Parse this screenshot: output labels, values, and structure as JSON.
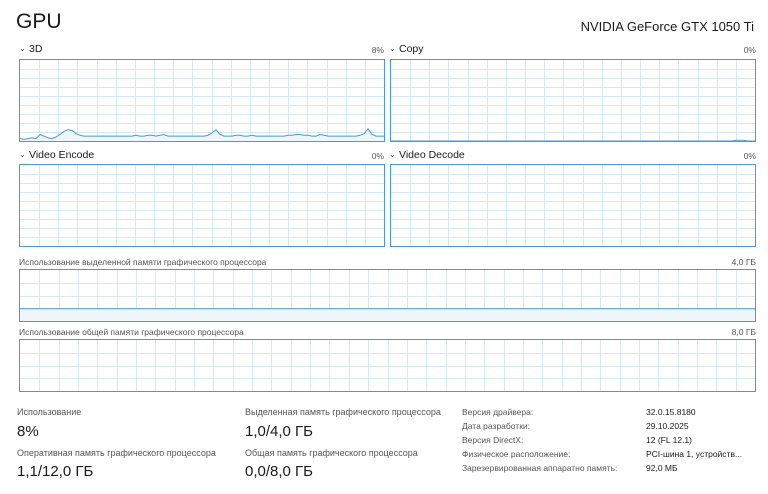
{
  "header": {
    "title": "GPU",
    "gpu_name": "NVIDIA GeForce GTX 1050 Ti"
  },
  "graphs": [
    {
      "label": "3D",
      "percent": "8%",
      "values": [
        3,
        2,
        3,
        4,
        3,
        8,
        6,
        4,
        3,
        5,
        8,
        12,
        14,
        13,
        9,
        7,
        6,
        6,
        6,
        6,
        6,
        6,
        6,
        6,
        6,
        6,
        6,
        6,
        6,
        7,
        6,
        6,
        7,
        7,
        6,
        7,
        8,
        6,
        6,
        6,
        6,
        6,
        6,
        6,
        6,
        6,
        6,
        7,
        10,
        14,
        8,
        6,
        6,
        6,
        7,
        7,
        6,
        6,
        7,
        6,
        6,
        6,
        6,
        6,
        6,
        6,
        6,
        7,
        7,
        8,
        8,
        7,
        7,
        6,
        6,
        8,
        7,
        6,
        6,
        6,
        6,
        6,
        6,
        6,
        6,
        7,
        9,
        15,
        8,
        6,
        6,
        6
      ]
    },
    {
      "label": "Copy",
      "percent": "0%",
      "values": [
        0,
        0,
        0,
        0,
        0,
        0,
        0,
        0,
        0,
        0,
        0,
        0,
        0,
        0,
        0,
        0,
        0,
        0,
        0,
        0,
        0,
        0,
        0,
        0,
        0,
        0,
        0,
        0,
        0,
        0,
        0,
        0,
        0,
        0,
        0,
        0,
        0,
        0,
        0,
        0,
        0,
        0,
        0,
        0,
        0,
        0,
        0,
        0,
        0,
        0,
        0,
        0,
        0,
        0,
        0,
        0,
        0,
        0,
        0,
        0,
        0,
        0,
        0,
        0,
        0,
        0,
        0,
        0,
        0,
        0,
        0,
        0,
        0,
        0,
        0,
        0,
        0,
        0,
        0,
        0,
        0,
        0,
        0,
        0,
        0,
        0,
        0,
        0,
        0,
        0,
        1,
        1,
        1,
        0,
        0,
        0
      ]
    },
    {
      "label": "Video Encode",
      "percent": "0%",
      "values": []
    },
    {
      "label": "Video Decode",
      "percent": "0%",
      "values": []
    }
  ],
  "memory": {
    "dedicated": {
      "label": "Использование выделенной памяти графического процессора",
      "max": "4,0 ГБ",
      "level": 0.25
    },
    "shared": {
      "label": "Использование общей памяти графического процессора",
      "max": "8,0 ГБ",
      "level": 0.0
    }
  },
  "stats": {
    "utilization": {
      "label": "Использование",
      "value": "8%"
    },
    "dedicated_mem": {
      "label": "Выделенная память графического процессора",
      "value": "1,0/4,0 ГБ"
    },
    "gpu_mem": {
      "label": "Оперативная память графического процессора",
      "value": "1,1/12,0 ГБ"
    },
    "shared_mem": {
      "label": "Общая память графического процессора",
      "value": "0,0/8,0 ГБ"
    }
  },
  "info": [
    {
      "label": "Версия драйвера:",
      "value": "32.0.15.8180"
    },
    {
      "label": "Дата разработки:",
      "value": "29.10.2025"
    },
    {
      "label": "Версия DirectX:",
      "value": "12 (FL 12.1)"
    },
    {
      "label": "Физическое расположение:",
      "value": "PCI-шина 1, устройств..."
    },
    {
      "label": "Зарезервированная аппаратно память:",
      "value": "92,0 МБ"
    }
  ],
  "colors": {
    "accent": "#4a9ad1",
    "grid": "#d7e8f5",
    "fill": "#eef5fb"
  }
}
